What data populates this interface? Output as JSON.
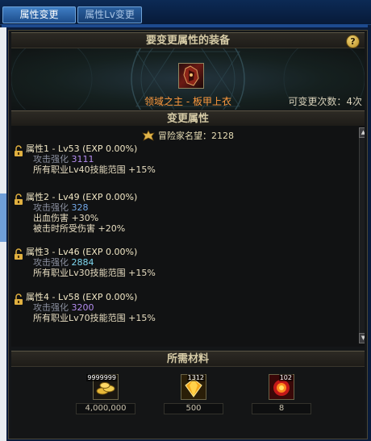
{
  "tabs": [
    {
      "label": "属性变更",
      "active": true
    },
    {
      "label": "属性Lv变更",
      "active": false
    }
  ],
  "equip_section": {
    "title": "要变更属性的装备",
    "help_icon": "?",
    "item_name": "领域之主 - 板甲上衣",
    "change_count": "可变更次数：4次"
  },
  "attr_section": {
    "title": "变更属性",
    "reputation": "冒险家名望：2128",
    "groups": [
      {
        "title": "属性1 - Lv53 (EXP 0.00%)",
        "lines": [
          {
            "label": "攻击强化",
            "value": "3111",
            "color": "purple"
          },
          {
            "text": "所有职业Lv40技能范围 +15%"
          }
        ]
      },
      {
        "title": "属性2 - Lv49 (EXP 0.00%)",
        "lines": [
          {
            "label": "攻击强化",
            "value": "328",
            "color": "blue"
          },
          {
            "text": "出血伤害 +30%"
          },
          {
            "text": "被击时所受伤害 +20%"
          }
        ]
      },
      {
        "title": "属性3 - Lv46 (EXP 0.00%)",
        "lines": [
          {
            "label": "攻击强化",
            "value": "2884",
            "color": "cyan"
          },
          {
            "text": "所有职业Lv30技能范围 +15%"
          }
        ]
      },
      {
        "title": "属性4 - Lv58 (EXP 0.00%)",
        "lines": [
          {
            "label": "攻击强化",
            "value": "3200",
            "color": "purple"
          },
          {
            "text": "所有职业Lv70技能范围 +15%"
          }
        ]
      }
    ]
  },
  "materials_section": {
    "title": "所需材料",
    "items": [
      {
        "icon": "gold-coins-icon",
        "count": "9999999",
        "value": "4,000,000"
      },
      {
        "icon": "gold-crystal-icon",
        "count": "1312",
        "value": "500"
      },
      {
        "icon": "explosion-orb-icon",
        "count": "102",
        "value": "8"
      }
    ]
  },
  "colors": {
    "item_name": "#ff9a3e",
    "value_purple": "#b48cf0",
    "value_blue": "#73a8e8",
    "value_cyan": "#7fd8f0"
  }
}
